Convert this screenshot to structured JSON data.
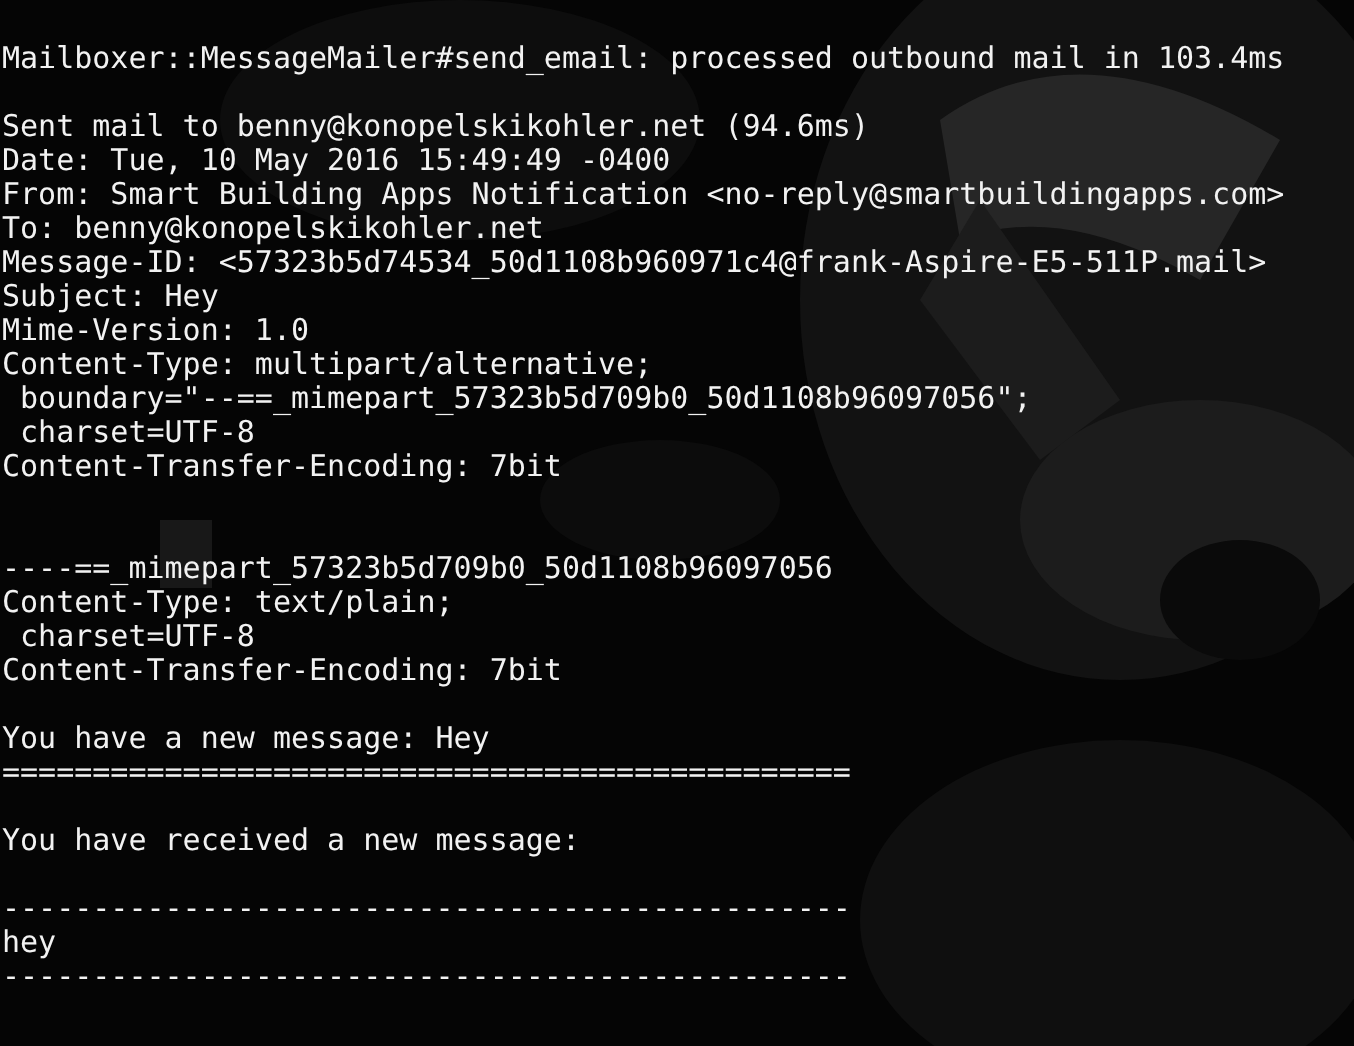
{
  "terminal": {
    "blocks": [
      {
        "kind": "section",
        "lines": [
          "Mailboxer::MessageMailer#send_email: processed outbound mail in 103.4ms"
        ]
      },
      {
        "kind": "section",
        "lines": [
          "Sent mail to benny@konopelskikohler.net (94.6ms)",
          "Date: Tue, 10 May 2016 15:49:49 -0400",
          "From: Smart Building Apps Notification <no-reply@smartbuildingapps.com>",
          "To: benny@konopelskikohler.net",
          "Message-ID: <57323b5d74534_50d1108b960971c4@frank-Aspire-E5-511P.mail>",
          "Subject: Hey",
          "Mime-Version: 1.0",
          "Content-Type: multipart/alternative;",
          " boundary=\"--==_mimepart_57323b5d709b0_50d1108b96097056\";",
          " charset=UTF-8",
          "Content-Transfer-Encoding: 7bit"
        ]
      },
      {
        "kind": "break",
        "lines": [
          "----==_mimepart_57323b5d709b0_50d1108b96097056",
          "Content-Type: text/plain;",
          " charset=UTF-8",
          "Content-Transfer-Encoding: 7bit"
        ]
      },
      {
        "kind": "section",
        "lines": [
          "You have a new message: Hey",
          "==============================================="
        ]
      },
      {
        "kind": "section",
        "lines": [
          "You have received a new message:"
        ]
      },
      {
        "kind": "section",
        "lines": [
          "-----------------------------------------------",
          "hey",
          "-----------------------------------------------"
        ]
      }
    ]
  }
}
